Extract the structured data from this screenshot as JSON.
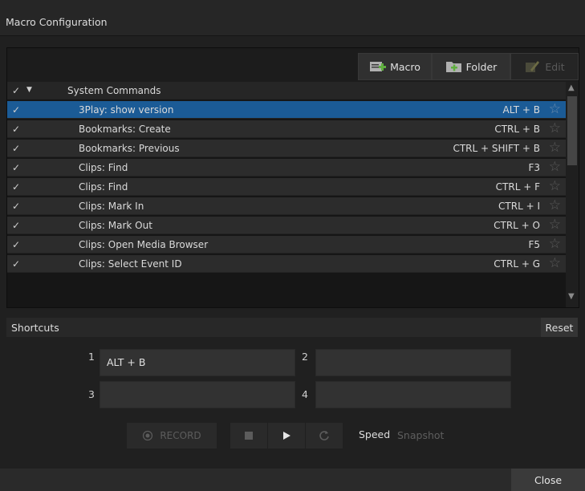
{
  "window": {
    "title": "Macro Configuration"
  },
  "toolbar": {
    "macro_label": "Macro",
    "folder_label": "Folder",
    "edit_label": "Edit"
  },
  "group": {
    "check": "✓",
    "expand": "▼",
    "name": "System Commands"
  },
  "rows": [
    {
      "check": "✓",
      "name": "3Play: show version",
      "key": "ALT + B",
      "selected": true
    },
    {
      "check": "✓",
      "name": "Bookmarks: Create",
      "key": "CTRL + B"
    },
    {
      "check": "✓",
      "name": "Bookmarks: Previous",
      "key": "CTRL + SHIFT + B"
    },
    {
      "check": "✓",
      "name": "Clips: Find",
      "key": "F3"
    },
    {
      "check": "✓",
      "name": "Clips: Find",
      "key": "CTRL + F"
    },
    {
      "check": "✓",
      "name": "Clips: Mark In",
      "key": "CTRL + I"
    },
    {
      "check": "✓",
      "name": "Clips: Mark Out",
      "key": "CTRL + O"
    },
    {
      "check": "✓",
      "name": "Clips: Open Media Browser",
      "key": "F5"
    },
    {
      "check": "✓",
      "name": "Clips: Select Event ID",
      "key": "CTRL + G"
    }
  ],
  "shortcuts": {
    "label": "Shortcuts",
    "reset_label": "Reset",
    "slots": [
      {
        "num": "1",
        "value": "ALT + B"
      },
      {
        "num": "2",
        "value": ""
      },
      {
        "num": "3",
        "value": ""
      },
      {
        "num": "4",
        "value": ""
      }
    ]
  },
  "controls": {
    "record_label": "RECORD",
    "speed_label": "Speed",
    "snapshot_label": "Snapshot"
  },
  "footer": {
    "close_label": "Close"
  },
  "colors": {
    "selection": "#1b5b96",
    "background": "#202020"
  }
}
